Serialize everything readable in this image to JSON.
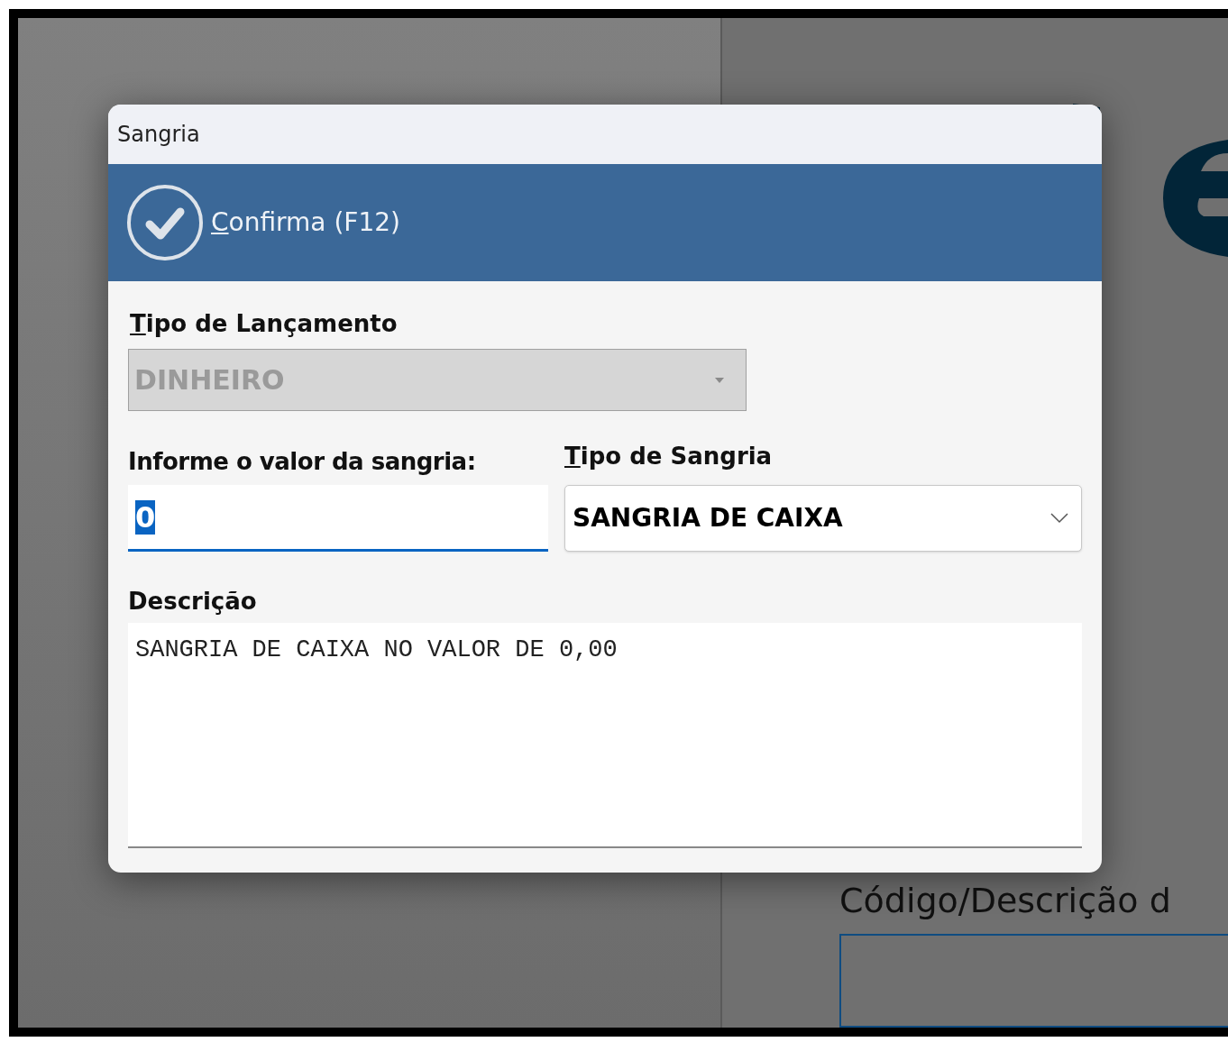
{
  "background": {
    "field_label": "Código/Descrição d"
  },
  "dialog": {
    "title": "Sangria",
    "toolbar": {
      "button": {
        "label": "Confirma (F12)",
        "mnemonic_underlined": true
      }
    },
    "tipo_lancamento": {
      "label": "Tipo de Lançamento",
      "mnemonic_underlined": true,
      "value": "DINHEIRO",
      "disabled": true
    },
    "valor": {
      "label": "Informe o valor da sangria:",
      "value": "0",
      "focused": true,
      "value_selected": true
    },
    "tipo_sangria": {
      "label": "Tipo de Sangria",
      "mnemonic_underlined": true,
      "value": "SANGRIA DE CAIXA",
      "disabled": false
    },
    "descricao": {
      "label": "Descrição",
      "value": "SANGRIA DE CAIXA NO VALOR DE 0,00"
    }
  }
}
